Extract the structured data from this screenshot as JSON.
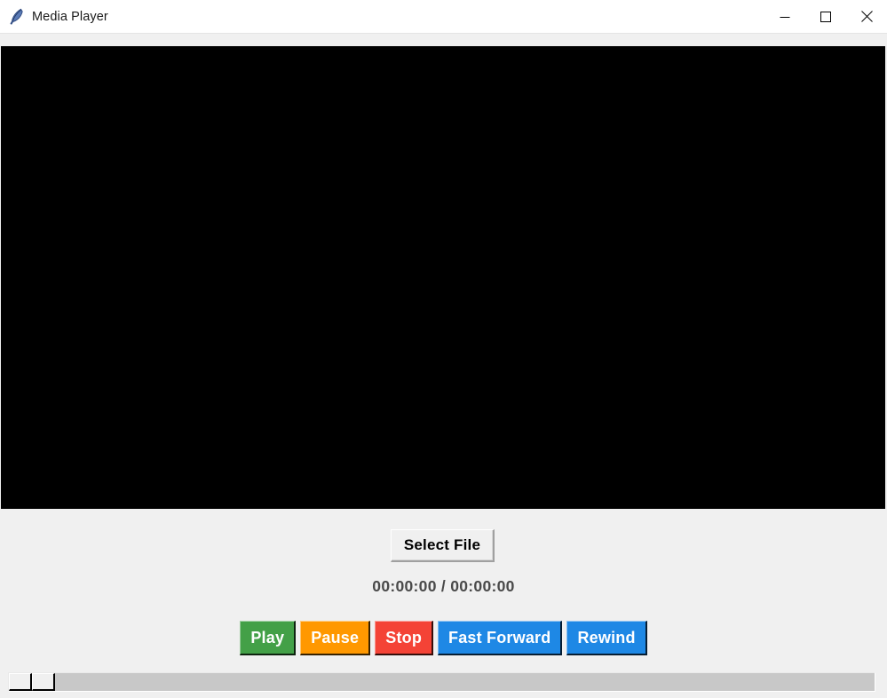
{
  "window": {
    "title": "Media Player",
    "icon": "feather-icon",
    "background": "#f0f0f0",
    "controls": {
      "minimize_label": "Minimize",
      "maximize_label": "Maximize",
      "close_label": "Close"
    }
  },
  "video": {
    "background": "#000000",
    "content": ""
  },
  "controls": {
    "select_file_label": "Select File",
    "time_display": "00:00:00 / 00:00:00",
    "current_time": "00:00:00",
    "total_time": "00:00:00",
    "buttons": [
      {
        "label": "Play",
        "color": "#43a047",
        "name": "play-button"
      },
      {
        "label": "Pause",
        "color": "#ff9800",
        "name": "pause-button"
      },
      {
        "label": "Stop",
        "color": "#f44336",
        "name": "stop-button"
      },
      {
        "label": "Fast Forward",
        "color": "#1e88e5",
        "name": "fast-forward-button"
      },
      {
        "label": "Rewind",
        "color": "#1e88e5",
        "name": "rewind-button"
      }
    ]
  },
  "seekbar": {
    "trough_color": "#c8c8c8",
    "thumb_color": "#f0f0f0",
    "position": 0
  }
}
